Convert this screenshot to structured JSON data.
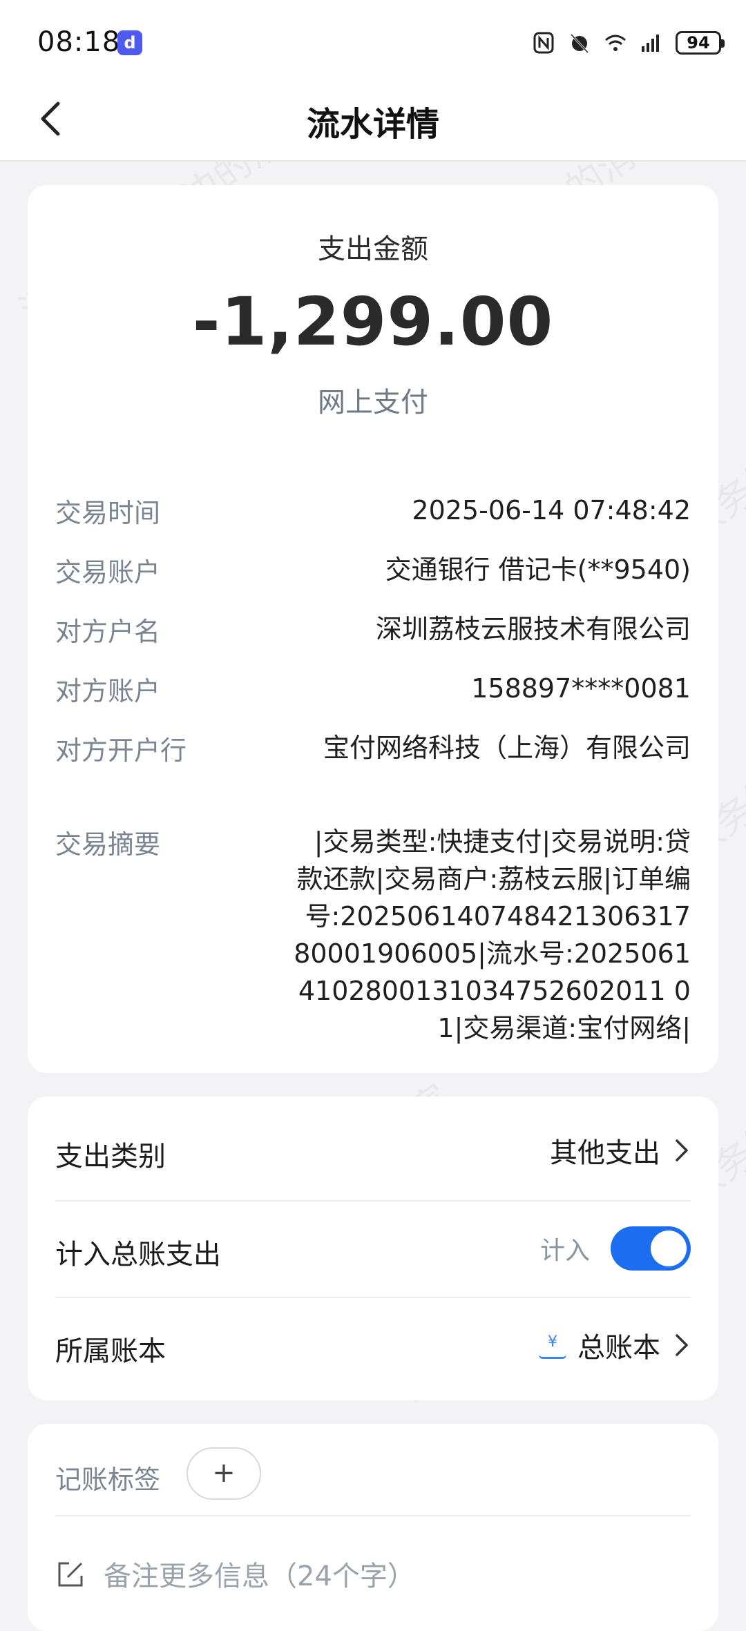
{
  "status_bar": {
    "time": "08:18",
    "app_badge": "d",
    "battery": "94"
  },
  "header": {
    "title": "流水详情"
  },
  "summary": {
    "amount_label": "支出金额",
    "amount": "-1,299.00",
    "method": "网上支付"
  },
  "details": [
    {
      "key": "交易时间",
      "value": "2025-06-14 07:48:42"
    },
    {
      "key": "交易账户",
      "value": "交通银行 借记卡(**9540)"
    },
    {
      "key": "对方户名",
      "value": "深圳荔枝云服技术有限公司"
    },
    {
      "key": "对方账户",
      "value": "158897****0081"
    },
    {
      "key": "对方开户行",
      "value": "宝付网络科技（上海）有限公司"
    },
    {
      "key": "交易摘要",
      "value": "|交易类型:快捷支付|交易说明:贷款还款|交易商户:荔枝云服|订单编号:20250614074842130631780001906005|流水号:20250614102800131034752602011 01|交易渠道:宝付网络|"
    }
  ],
  "settings": {
    "category_label": "支出类别",
    "category_value": "其他支出",
    "include_label": "计入总账支出",
    "include_state": "计入",
    "include_on": true,
    "ledger_label": "所属账本",
    "ledger_value": "总账本",
    "ledger_icon": "yen-book-icon"
  },
  "extras": {
    "tag_label": "记账标签",
    "add_tag": "+",
    "note_placeholder": "备注更多信息（24个字）"
  },
  "watermark": "消费保 您身边的消费服务管家"
}
